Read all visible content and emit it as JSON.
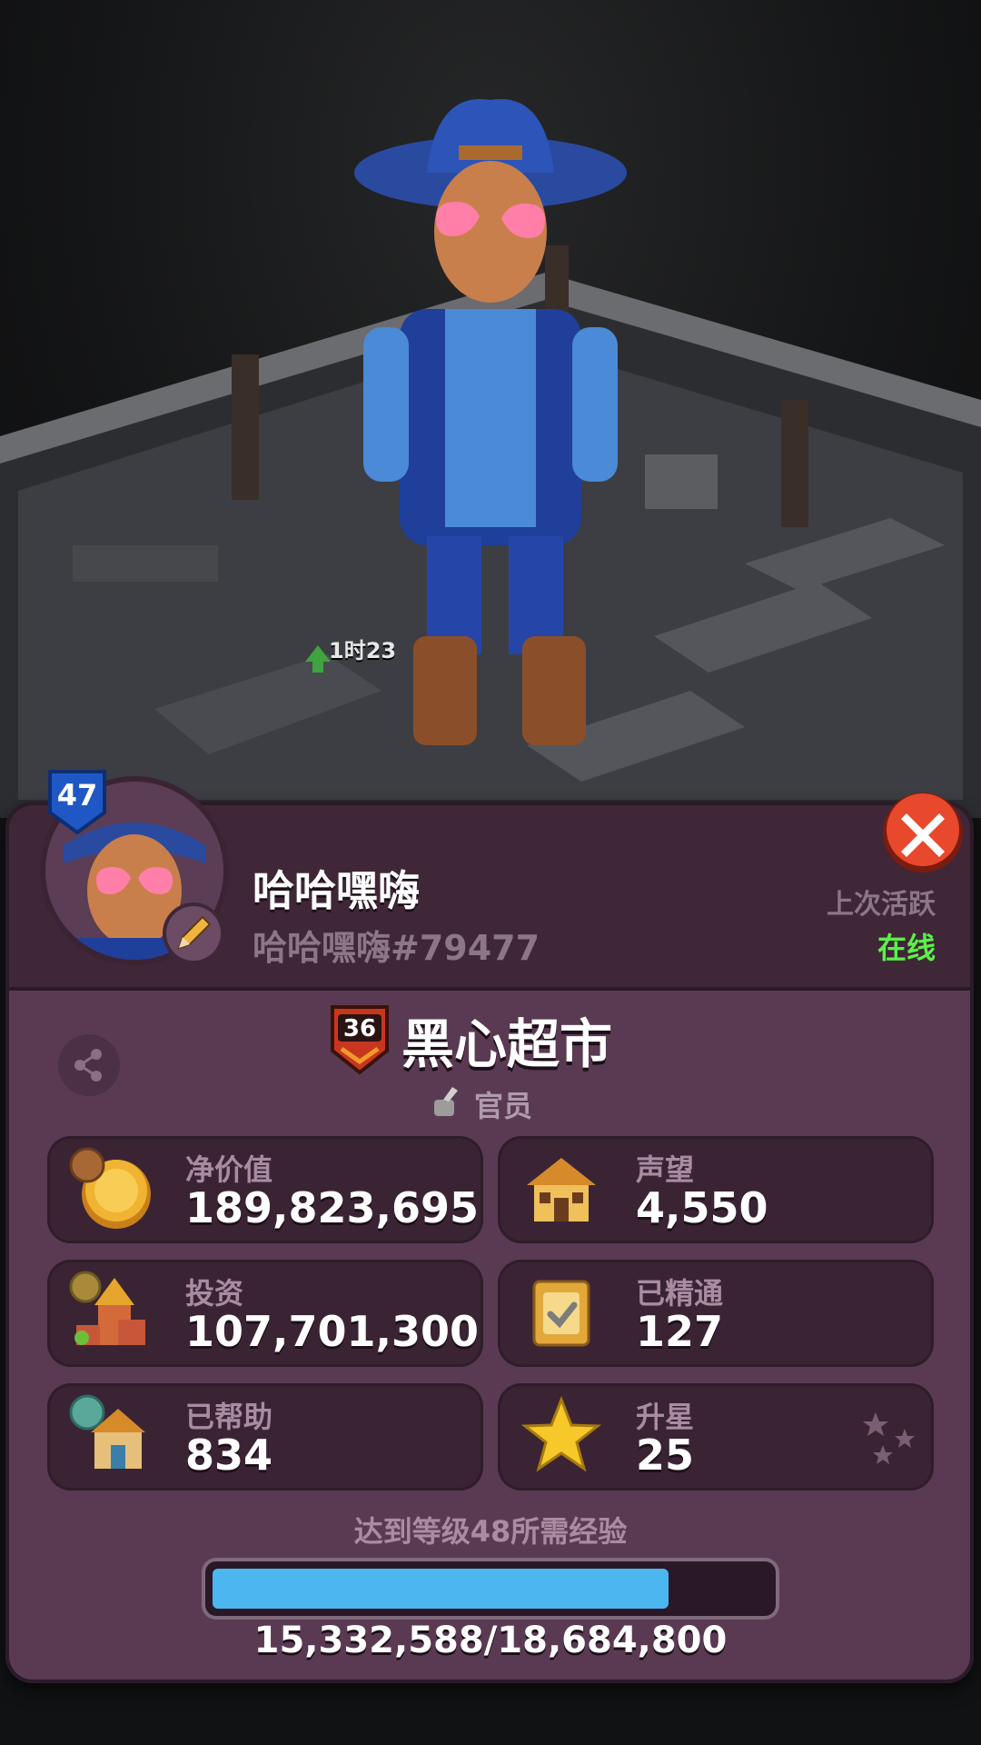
{
  "player": {
    "level": "47",
    "name": "哈哈嘿嗨",
    "tag": "哈哈嘿嗨#79477",
    "last_active_label": "上次活跃",
    "status": "在线"
  },
  "scene": {
    "timer_text": "1时23"
  },
  "guild": {
    "level": "36",
    "name": "黑心超市",
    "role": "官员"
  },
  "stats": [
    {
      "label": "净价值",
      "value": "189,823,695",
      "icon": "gold-coin-icon"
    },
    {
      "label": "声望",
      "value": "4,550",
      "icon": "shop-building-icon"
    },
    {
      "label": "投资",
      "value": "107,701,300",
      "icon": "investment-buildings-icon"
    },
    {
      "label": "已精通",
      "value": "127",
      "icon": "mastery-scroll-icon"
    },
    {
      "label": "已帮助",
      "value": "834",
      "icon": "help-shop-icon"
    },
    {
      "label": "升星",
      "value": "25",
      "icon": "star-icon"
    }
  ],
  "experience": {
    "label": "达到等级48所需经验",
    "current": 15332588,
    "required": 18684800,
    "text": "15,332,588/18,684,800",
    "progress": 0.8206
  },
  "colors": {
    "panel": "#5a3a53",
    "header": "#3f2738",
    "stat_box": "#3a2434",
    "online": "#5cf04a",
    "progress": "#4cb6f0",
    "close_button": "#e8482b"
  }
}
